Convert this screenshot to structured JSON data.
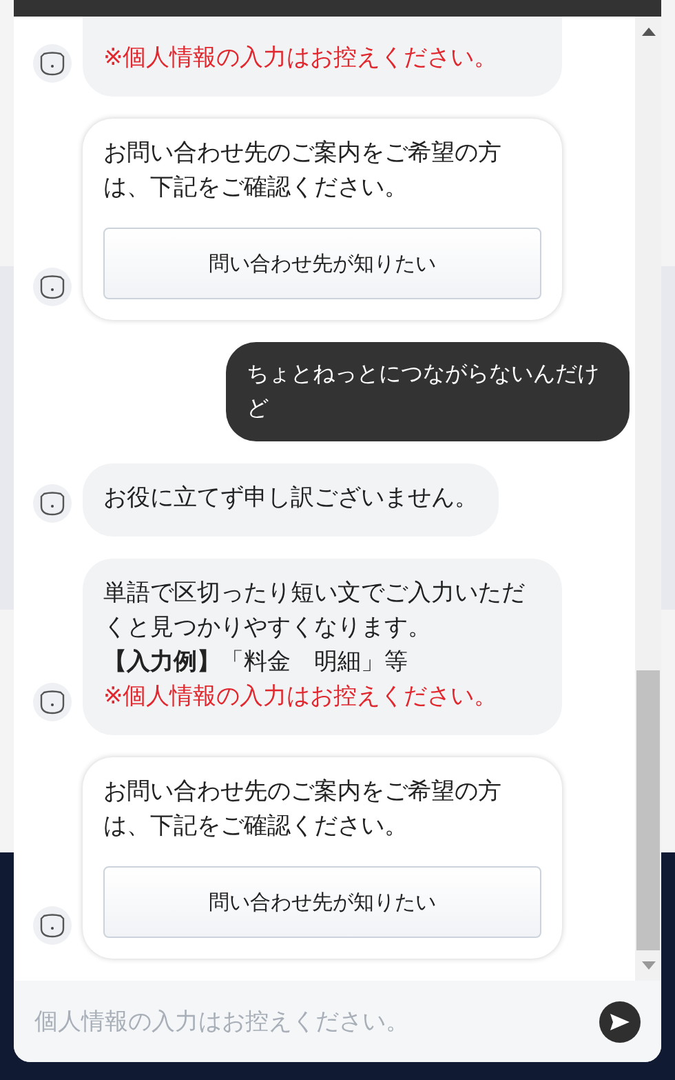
{
  "messages": [
    {
      "kind": "bot",
      "lines": [
        {
          "kind": "warning",
          "text": "※個人情報の入力はお控えください。"
        }
      ]
    },
    {
      "kind": "bot",
      "lines": [
        {
          "kind": "text",
          "text": "お問い合わせ先のご案内をご希望の方は、下記をご確認ください。"
        }
      ],
      "button": "問い合わせ先が知りたい"
    },
    {
      "kind": "user",
      "lines": [
        "ちょとねっとにつながらないんだけど"
      ]
    },
    {
      "kind": "bot",
      "lines": [
        {
          "kind": "text",
          "text": "お役に立てず申し訳ございません。"
        }
      ]
    },
    {
      "kind": "bot",
      "lines": [
        {
          "kind": "text",
          "text": "単語で区切ったり短い文でご入力いただくと見つかりやすくなります。"
        },
        {
          "kind": "text",
          "text": "**【入力例】**「料金　明細」等"
        },
        {
          "kind": "warning",
          "text": "※個人情報の入力はお控えください。"
        }
      ]
    },
    {
      "kind": "bot",
      "lines": [
        {
          "kind": "text",
          "text": "お問い合わせ先のご案内をご希望の方は、下記をご確認ください。"
        }
      ],
      "button": "問い合わせ先が知りたい"
    }
  ],
  "input": {
    "placeholder": "個人情報の入力はお控えください。"
  }
}
